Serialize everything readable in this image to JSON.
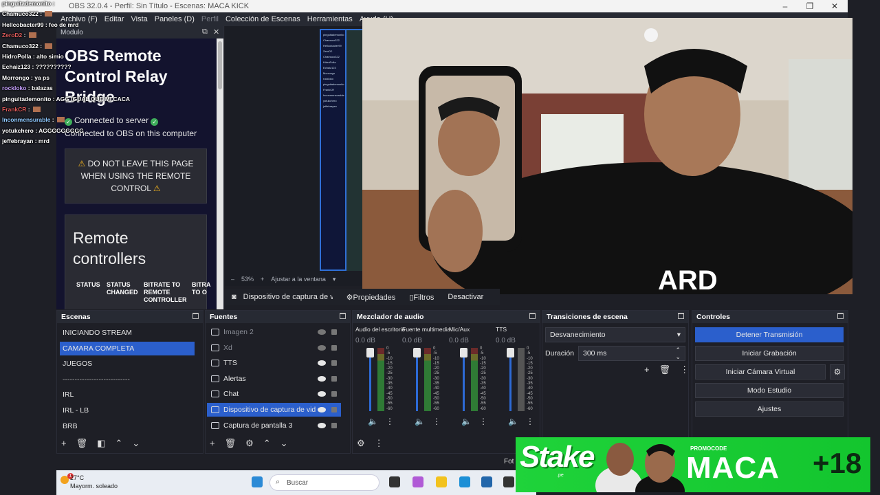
{
  "window": {
    "title": "OBS 32.0.4 - Perfil: Sin Título - Escenas: MACA KICK"
  },
  "menu": [
    "Archivo (F)",
    "Editar",
    "Vista",
    "Paneles (D)",
    "Perfil",
    "Colección de Escenas",
    "Herramientas",
    "Ayuda (H)"
  ],
  "chat": [
    {
      "user": "pinguitademonito",
      "msg": "",
      "emote": false,
      "color": "#ffffff"
    },
    {
      "user": "Chamuco322",
      "msg": "",
      "emote": true,
      "color": "#ffffff"
    },
    {
      "user": "Hellcobacter99",
      "msg": "feo de mrd",
      "emote": false,
      "color": "#ffffff"
    },
    {
      "user": "ZeroD2",
      "msg": "",
      "emote": true,
      "color": "#e05b5b"
    },
    {
      "user": "Chamuco322",
      "msg": "",
      "emote": true,
      "color": "#ffffff"
    },
    {
      "user": "HidroPolla",
      "msg": "alto simio",
      "emote": false,
      "color": "#ffffff"
    },
    {
      "user": "Echaiz123",
      "msg": "??????????",
      "emote": false,
      "color": "#ffffff"
    },
    {
      "user": "Morrongo",
      "msg": "ya ps",
      "emote": false,
      "color": "#ffffff"
    },
    {
      "user": "rockloko",
      "msg": "balazas",
      "emote": false,
      "color": "#c6a0ff"
    },
    {
      "user": "pinguitademonito",
      "msg": "AGG IGUAL QUE MI CACA",
      "emote": false,
      "color": "#ffffff"
    },
    {
      "user": "FrankCR",
      "msg": "",
      "emote": true,
      "color": "#e05b5b"
    },
    {
      "user": "Inconmensurable",
      "msg": "",
      "emote": true,
      "color": "#8fc9ff"
    },
    {
      "user": "yotukchero",
      "msg": "AGGGGGGGGG",
      "emote": false,
      "color": "#ffffff"
    },
    {
      "user": "jeffebrayan",
      "msg": "mrd",
      "emote": false,
      "color": "#ffffff"
    }
  ],
  "remote": {
    "dock_title": "Modulo",
    "title": "OBS Remote Control Relay Bridge",
    "status1": "Connected to server",
    "status2": "Connected to OBS on this computer",
    "warning": "DO NOT LEAVE THIS PAGE WHEN USING THE REMOTE CONTROL",
    "controllers_title": "Remote controllers",
    "columns": [
      "STATUS",
      "STATUS CHANGED",
      "BITRATE TO REMOTE CONTROLLER",
      "BITRA TO O"
    ]
  },
  "preview": {
    "zoom": "53%",
    "fit": "Ajustar a la ventana"
  },
  "source_toolbar": {
    "name": "Dispositivo de captura de v",
    "properties": "Propiedades",
    "filters": "Filtros",
    "deactivate": "Desactivar"
  },
  "scenes": {
    "title": "Escenas",
    "items": [
      "INICIANDO STREAM",
      "CAMARA COMPLETA",
      "JUEGOS",
      "----------------------------",
      "IRL",
      "IRL - LB",
      "BRB"
    ],
    "selected": 1
  },
  "sources": {
    "title": "Fuentes",
    "items": [
      {
        "name": "Imagen 2",
        "dim": true
      },
      {
        "name": "Xd",
        "dim": true
      },
      {
        "name": "TTS",
        "dim": false
      },
      {
        "name": "Alertas",
        "dim": false
      },
      {
        "name": "Chat",
        "dim": false
      },
      {
        "name": "Dispositivo de captura de video",
        "dim": false
      },
      {
        "name": "Captura de pantalla 3",
        "dim": false
      }
    ],
    "selected": 5
  },
  "mixer": {
    "title": "Mezclador de audio",
    "channels": [
      {
        "name": "Audio del escritorio",
        "db": "0.0 dB"
      },
      {
        "name": "Fuente multimedia",
        "db": "0.0 dB"
      },
      {
        "name": "Mic/Aux",
        "db": "0.0 dB"
      },
      {
        "name": "TTS",
        "db": "0.0 dB"
      }
    ],
    "ticks": [
      "0",
      "-5",
      "-10",
      "-15",
      "-20",
      "-25",
      "-30",
      "-35",
      "-40",
      "-45",
      "-50",
      "-55",
      "-60"
    ]
  },
  "transitions": {
    "title": "Transiciones de escena",
    "selected": "Desvanecimiento",
    "duration_label": "Duración",
    "duration_value": "300 ms"
  },
  "controls": {
    "title": "Controles",
    "buttons": [
      "Detener Transmisión",
      "Iniciar Grabación",
      "Iniciar Cámara Virtual",
      "Modo Estudio",
      "Ajustes"
    ]
  },
  "taskbar": {
    "temp": "27°C",
    "weather": "Mayorm. soleado",
    "search": "Buscar",
    "notif": "1"
  },
  "status": {
    "frame": "Fot"
  },
  "banner": {
    "brand": "Stake",
    "brand_sub": ".pe",
    "promo_label": "PROMOCODE",
    "code": "MACA",
    "age": "+18"
  }
}
